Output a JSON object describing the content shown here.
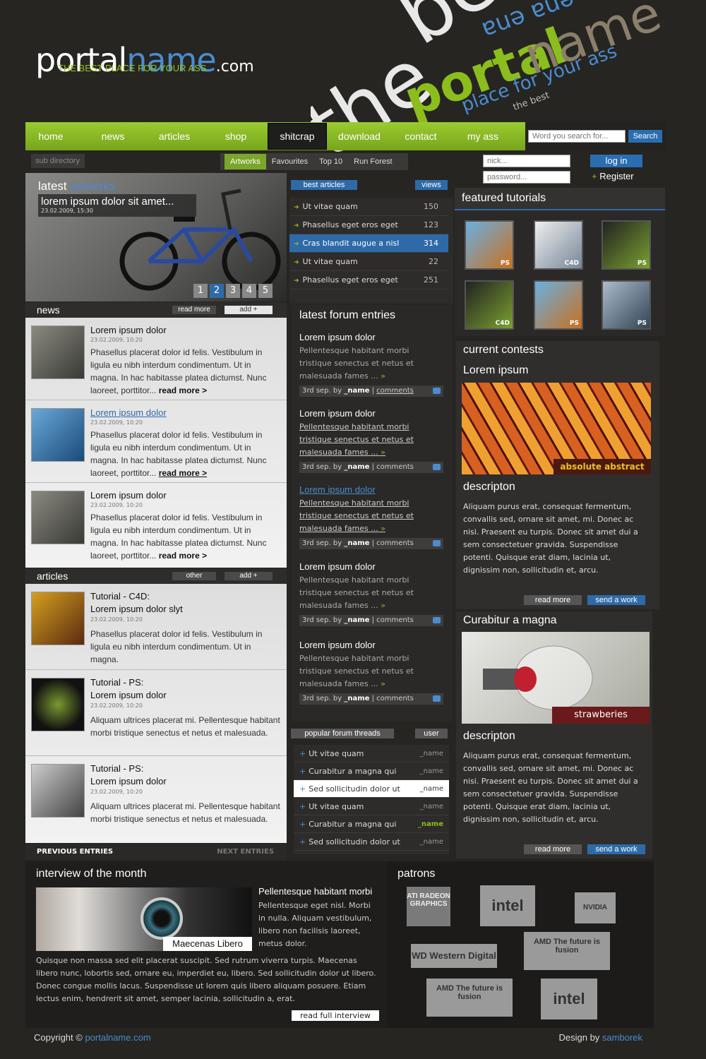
{
  "brand": {
    "name_part1": "portal",
    "name_part2": "name",
    "tld": ".com",
    "tagline": "THE BEST PLACE FOR YOUR ASS"
  },
  "decor": {
    "the": "the",
    "be": "be",
    "portal": "portal",
    "name": "name",
    "place": "place for your ass",
    "mirror": "ɐuǝ ɐuǝ",
    "best": "the best"
  },
  "nav": {
    "items": [
      "home",
      "news",
      "articles",
      "shop",
      "shitcrap",
      "download",
      "contact",
      "my ass"
    ],
    "active": "shitcrap"
  },
  "search": {
    "placeholder": "Word you search for...",
    "button": "Search"
  },
  "login": {
    "nick": "nick...",
    "password": "password...",
    "login_button": "log in",
    "register": "Register"
  },
  "subdir": "sub directory",
  "subtabs": [
    "Artworks",
    "Favourites",
    "Top 10",
    "Run Forest"
  ],
  "hero": {
    "title_a": "latest",
    "title_b": "artworks",
    "caption": "lorem ipsum dolor sit amet...",
    "date": "23.02.2009, 15:30",
    "pages": [
      "1",
      "2",
      "3",
      "4",
      "5"
    ],
    "active_page": "2"
  },
  "news": {
    "title": "news",
    "read_more": "read more",
    "add": "add +",
    "items": [
      {
        "title": "Lorem ipsum dolor",
        "date": "23.02.2009, 10:20",
        "text": "Phasellus placerat dolor id felis. Vestibulum in ligula eu nibh interdum condimentum. Ut in magna. In hac habitasse platea dictumst. Nunc laoreet, porttitor...",
        "more": "read more >"
      },
      {
        "title": "Lorem ipsum dolor",
        "date": "23.02.2009, 10:20",
        "text": "Phasellus placerat dolor id felis. Vestibulum in ligula eu nibh interdum condimentum. Ut in magna. In hac habitasse platea dictumst. Nunc laoreet, porttitor...",
        "more": "read more >"
      },
      {
        "title": "Lorem ipsum dolor",
        "date": "23.02.2009, 10:20",
        "text": "Phasellus placerat dolor id felis. Vestibulum in ligula eu nibh interdum condimentum. Ut in magna. In hac habitasse platea dictumst. Nunc laoreet, porttitor...",
        "more": "read more >"
      }
    ]
  },
  "articles": {
    "title": "articles",
    "other": "other",
    "add": "add +",
    "items": [
      {
        "title": "Tutorial - C4D:",
        "subtitle": "Lorem ipsum dolor slyt",
        "date": "23.02.2009, 10:20",
        "text": "Phasellus placerat dolor id felis. Vestibulum in ligula eu nibh interdum condimentum. Ut in magna."
      },
      {
        "title": "Tutorial - PS:",
        "subtitle": "Lorem ipsum dolor",
        "date": "23.02.2009, 10:20",
        "text": "Aliquam ultrices placerat mi. Pellentesque habitant morbi tristique senectus et netus et malesuada."
      },
      {
        "title": "Tutorial - PS:",
        "subtitle": "Lorem ipsum dolor",
        "date": "23.02.2009, 10:20",
        "text": "Aliquam ultrices placerat mi. Pellentesque habitant morbi tristique senectus et netus et malesuada."
      }
    ],
    "prev": "PREVIOUS ENTRIES",
    "next": "NEXT ENTRIES"
  },
  "best_articles": {
    "title": "best articles",
    "views": "views",
    "items": [
      {
        "label": "Ut vitae quam",
        "views": "150"
      },
      {
        "label": "Phasellus eget eros eget",
        "views": "123"
      },
      {
        "label": "Cras blandit augue a nisl",
        "views": "314"
      },
      {
        "label": "Ut vitae quam",
        "views": "22"
      },
      {
        "label": "Phasellus eget eros eget",
        "views": "251"
      }
    ]
  },
  "forum": {
    "title": "latest forum entries",
    "items": [
      {
        "title": "Lorem ipsum dolor",
        "text": "Pellentesque habitant morbi tristique senectus et netus et malesuada fames ...",
        "meta": "3rd sep. by",
        "name": "_name",
        "comments": "comments"
      },
      {
        "title": "Lorem ipsum dolor",
        "text": "Pellentesque habitant morbi tristique senectus et netus et malesuada fames ...",
        "meta": "3rd sep. by",
        "name": "_name",
        "comments": "comments"
      },
      {
        "title": "Lorem ipsum dolor",
        "text": "Pellentesque habitant morbi tristique senectus et netus et malesuada fames ...",
        "meta": "3rd sep. by",
        "name": "_name",
        "comments": "comments"
      },
      {
        "title": "Lorem ipsum dolor",
        "text": "Pellentesque habitant morbi tristique senectus et netus et malesuada fames ...",
        "meta": "3rd sep. by",
        "name": "_name",
        "comments": "comments"
      },
      {
        "title": "Lorem ipsum dolor",
        "text": "Pellentesque habitant morbi tristique senectus et netus et malesuada fames ...",
        "meta": "3rd sep. by",
        "name": "_name",
        "comments": "comments"
      }
    ]
  },
  "popular": {
    "title": "popular forum threads",
    "user": "user",
    "items": [
      {
        "label": "Ut vitae quam",
        "user": "_name"
      },
      {
        "label": "Curabitur a magna qui",
        "user": "_name"
      },
      {
        "label": "Sed sollicitudin dolor ut",
        "user": "_name"
      },
      {
        "label": "Ut vitae quam",
        "user": "_name"
      },
      {
        "label": "Curabitur a magna qui",
        "user": "_name"
      },
      {
        "label": "Sed sollicitudin dolor ut",
        "user": "_name"
      }
    ]
  },
  "tutorials": {
    "title": "featured tutorials",
    "items": [
      "PS",
      "C4D",
      "PS",
      "C4D",
      "PS",
      "PS"
    ]
  },
  "contests": {
    "title": "current contests",
    "items": [
      {
        "heading": "Lorem ipsum",
        "tag": "absolute abstract",
        "desc_title": "descripton",
        "desc": "Aliquam purus erat, consequat fermentum, convallis sed, ornare sit amet, mi. Donec ac nisi. Praesent eu turpis. Donec sit amet dui a sem consectetuer gravida. Suspendisse potenti. Quisque erat diam, lacinia ut, dignissim non, sollicitudin et, arcu.",
        "read_more": "read more",
        "send": "send a work"
      },
      {
        "heading": "Curabitur a magna",
        "tag": "strawberies",
        "desc_title": "descripton",
        "desc": "Aliquam purus erat, consequat fermentum, convallis sed, ornare sit amet, mi. Donec ac nisi. Praesent eu turpis. Donec sit amet dui a sem consectetuer gravida. Suspendisse potenti. Quisque erat diam, lacinia ut, dignissim non, sollicitudin et, arcu.",
        "read_more": "read more",
        "send": "send a work"
      }
    ]
  },
  "interview": {
    "title": "interview of the month",
    "name": "Maecenas Libero",
    "subtitle": "Pellentesque habitant morbi",
    "side_text": "Pellentesque eget nisl. Morbi in nulla. Aliquam vestibulum, libero non facilisis laoreet, metus dolor.",
    "text": "Quisque non massa sed elit placerat suscipit. Sed rutrum viverra turpis. Maecenas libero nunc, lobortis sed, ornare eu, imperdiet eu, libero. Sed sollicitudin dolor ut libero. Donec congue mollis lacus. Suspendisse ut lorem quis libero aliquam posuere. Etiam lectus enim, hendrerit sit amet, semper lacinia, sollicitudin a, erat.",
    "button": "read full interview"
  },
  "patrons": {
    "title": "patrons",
    "logos": [
      "ATI RADEON GRAPHICS",
      "intel",
      "NVIDIA",
      "WD Western Digital",
      "AMD The future is fusion",
      "AMD The future is fusion",
      "intel"
    ]
  },
  "footer": {
    "copyright": "Copyright ©",
    "site": "portalname.com",
    "design_by": "Design by",
    "designer": "samborek"
  }
}
